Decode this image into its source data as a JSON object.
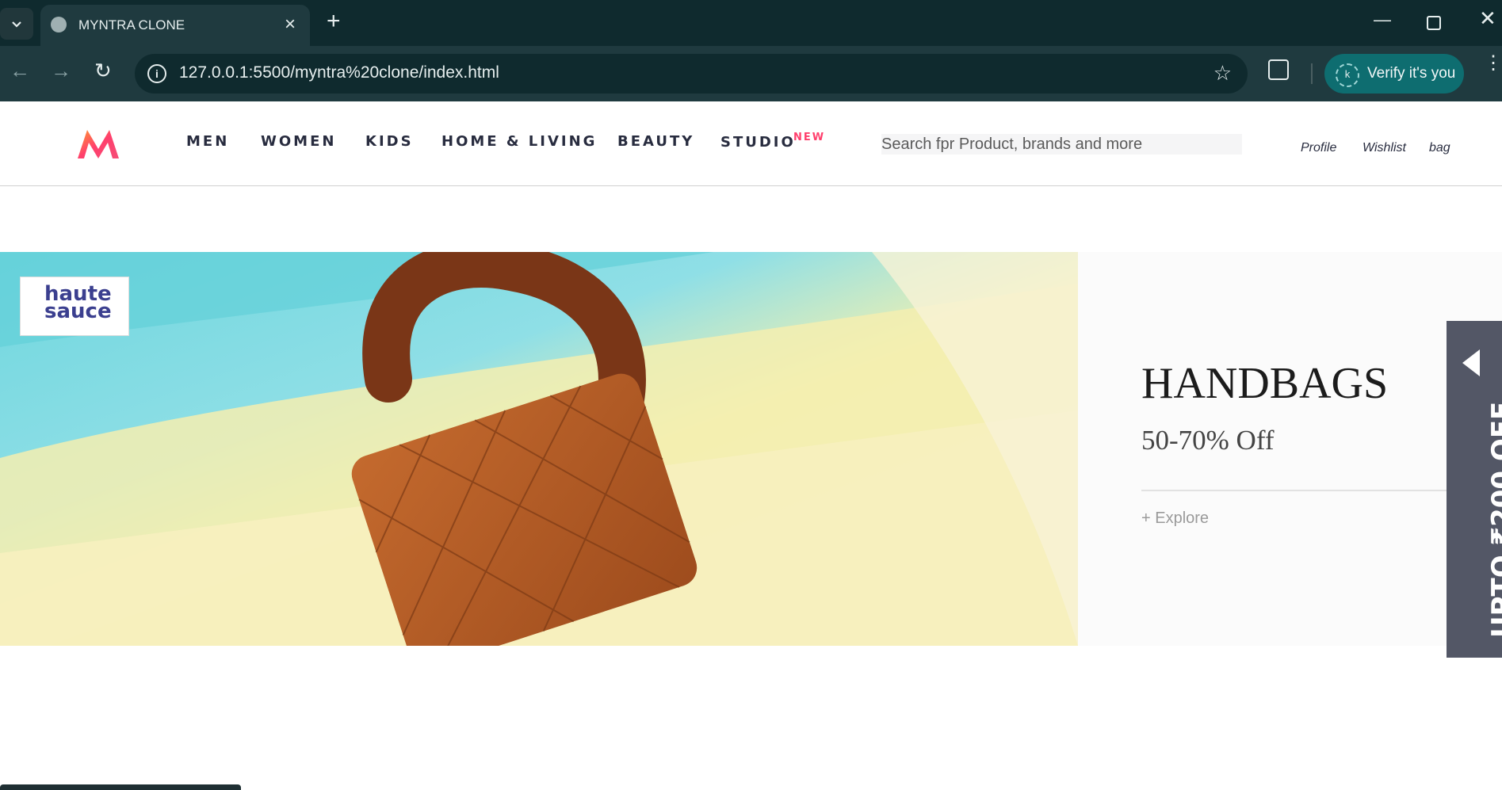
{
  "browser": {
    "tab_title": "MYNTRA CLONE",
    "url": "127.0.0.1:5500/myntra%20clone/index.html",
    "verify_label": "Verify it's you",
    "verify_avatar_letter": "k",
    "colors": {
      "tabstrip": "#0f2a2e",
      "toolbar": "#1f3a3f",
      "verify_chip": "#0e6d70"
    }
  },
  "header": {
    "nav": [
      {
        "label": "MEN"
      },
      {
        "label": "WOMEN"
      },
      {
        "label": "KIDS"
      },
      {
        "label": "HOME & LIVING"
      },
      {
        "label": "BEAUTY"
      },
      {
        "label": "STUDIO"
      }
    ],
    "studio_badge": "NEW",
    "search_placeholder": "Search fpr Product, brands and more",
    "actions": [
      {
        "label": "Profile"
      },
      {
        "label": "Wishlist"
      },
      {
        "label": "bag"
      }
    ],
    "accent_color": "#ff3f6c"
  },
  "banner": {
    "brand": "haute sauce",
    "title": "HANDBAGS",
    "discount": "50-70% Off",
    "explore": "+ Explore"
  },
  "side_offer": {
    "label": "UPTO ₹200 OFF"
  }
}
